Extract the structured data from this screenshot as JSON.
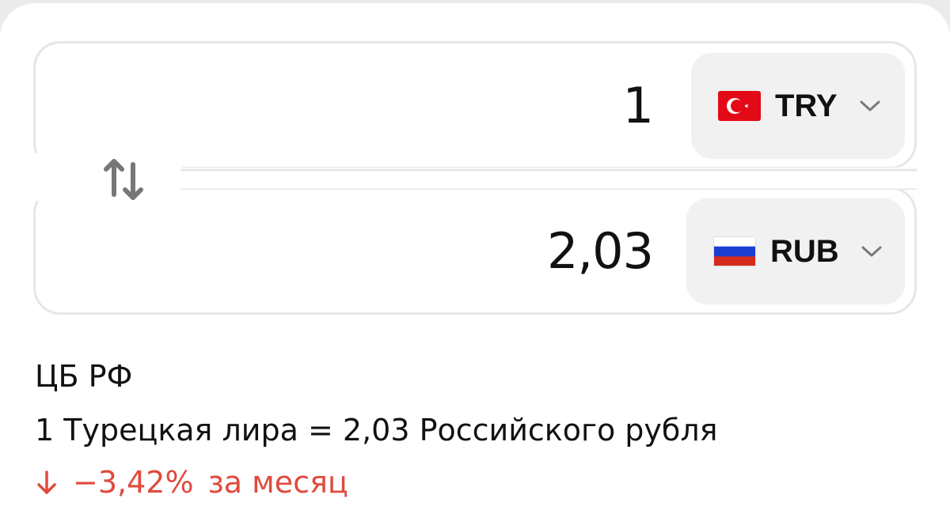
{
  "converter": {
    "from": {
      "amount": "1",
      "currency_code": "TRY",
      "flag_icon": "turkey-flag-icon"
    },
    "to": {
      "amount": "2,03",
      "currency_code": "RUB",
      "flag_icon": "russia-flag-icon"
    },
    "swap_icon": "swap-arrows-icon"
  },
  "info": {
    "source": "ЦБ РФ",
    "rate_text": "1 Турецкая лира = 2,03 Российского рубля",
    "change_value": "−3,42%",
    "change_period": "за месяц",
    "change_direction": "down",
    "change_color": "#e04a3d"
  }
}
